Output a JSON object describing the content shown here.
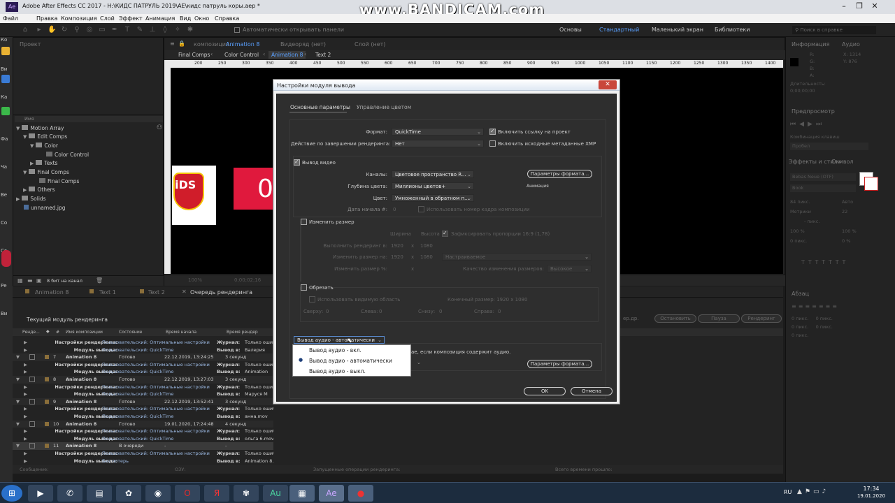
{
  "window": {
    "title": "Adobe After Effects CC 2017 - H:\\КИДС ПАТРУЛЬ 2019\\AE\\кидс патруль коры.aep *"
  },
  "watermark": "www.BANDICAM.com",
  "menu": [
    "Файл",
    "Правка",
    "Композиция",
    "Слой",
    "Эффект",
    "Анимация",
    "Вид",
    "Окно",
    "Справка"
  ],
  "toolbar": {
    "auto_panels": "Автоматически открывать панели",
    "workspaces": [
      "Основы",
      "Стандартный",
      "Маленький экран",
      "Библиотеки"
    ],
    "active_workspace": "Стандартный",
    "search_placeholder": "Поиск в справке"
  },
  "left_edge": [
    "Ко",
    "Ви",
    "Ка",
    "Фа",
    "Ча",
    "Ве",
    "Со",
    "Со",
    "Ре",
    "Ви"
  ],
  "project": {
    "tab": "Проект",
    "col_name": "Имя",
    "bits": "8 бит на канал",
    "items": [
      {
        "name": "Motion Array",
        "level": 0,
        "type": "folder"
      },
      {
        "name": "Edit Comps",
        "level": 1,
        "type": "folder"
      },
      {
        "name": "Color",
        "level": 2,
        "type": "folder"
      },
      {
        "name": "Color Control",
        "level": 3,
        "type": "comp"
      },
      {
        "name": "Texts",
        "level": 2,
        "type": "folder"
      },
      {
        "name": "Final Comps",
        "level": 1,
        "type": "folder"
      },
      {
        "name": "Final Comps",
        "level": 2,
        "type": "comp"
      },
      {
        "name": "Others",
        "level": 1,
        "type": "folder"
      },
      {
        "name": "Solids",
        "level": 0,
        "type": "folder"
      },
      {
        "name": "unnamed.jpg",
        "level": 0,
        "type": "file"
      }
    ]
  },
  "comp_panel": {
    "tab_prefix": "композиция",
    "tab_name": "Animation 8",
    "footage": "Видеоряд (нет)",
    "layer": "Слой (нет)",
    "breadcrumb": [
      "Final Comps",
      "Color Control",
      "Animation 8",
      "Text 2"
    ],
    "active_crumb": "Animation 8",
    "ruler": [
      "200",
      "250",
      "300",
      "350",
      "400",
      "450",
      "500",
      "550",
      "600",
      "650",
      "700",
      "750",
      "800",
      "850",
      "900",
      "950",
      "1000",
      "1050",
      "1100",
      "1150",
      "1200",
      "1250",
      "1300",
      "1350",
      "1400",
      "1450"
    ],
    "logo_text": "iDS",
    "block_text": "0",
    "zoom": "100%",
    "timecode": "0;00;02;16"
  },
  "dialog": {
    "title": "Настройки модуля вывода",
    "close": "✕",
    "tabs": [
      "Основные параметры",
      "Управление цветом"
    ],
    "format_label": "Формат:",
    "format_value": "QuickTime",
    "include_link": "Включить ссылку на проект",
    "post_render_label": "Действие по завершении рендеринга:",
    "post_render_value": "Нет",
    "include_xmp": "Включить исходные метаданные XMP",
    "video_output": "Вывод видео",
    "channels_label": "Каналы:",
    "channels_value": "Цветовое пространство R...",
    "format_options": "Параметры формата...",
    "depth_label": "Глубина цвета:",
    "depth_value": "Миллионы цветов+",
    "codec_note": "Анимация",
    "color_label": "Цвет:",
    "color_value": "Умноженный в обратном п...",
    "start_label": "Дата начала #:",
    "start_value": "0",
    "use_comp_frame": "Использовать номер кадра композиции",
    "resize": "Изменить размер",
    "width": "Ширина",
    "height": "Высота",
    "lock_ratio": "Зафиксировать пропорции 16:9 (1,78)",
    "render_at": "Выполнить рендеринг в:",
    "render_w": "1920",
    "render_h": "1080",
    "resize_to": "Изменить размер на:",
    "resize_w": "1920",
    "resize_h": "1080",
    "custom": "Настраиваемое",
    "resize_pct": "Изменить размер %:",
    "resize_quality": "Качество изменения размеров:",
    "quality_value": "Высокое",
    "crop": "Обрезать",
    "use_roi": "Использовать видимую область",
    "final_size": "Конечный размер: 1920 x 1080",
    "top": "Сверху:",
    "top_v": "0",
    "left": "Слева:",
    "left_v": "0",
    "bottom": "Снизу:",
    "bottom_v": "0",
    "right": "Справа:",
    "right_v": "0",
    "audio_select": "Вывод аудио - автоматически",
    "audio_note": "ае, если композиция содержит аудио.",
    "audio_options": "Параметры формата...",
    "ok": "OK",
    "cancel": "Отмена"
  },
  "audio_popup": {
    "options": [
      "Вывод аудио - вкл.",
      "Вывод аудио - автоматически",
      "Вывод аудио - выкл."
    ],
    "selected": 1
  },
  "render_queue": {
    "tabs": [
      "Animation 8",
      "Text 1",
      "Text 2",
      "Очередь рендеринга"
    ],
    "header": "Текущий модуль рендеринга",
    "cols": [
      "Ренде...",
      "#",
      "Имя композиции",
      "Состояние",
      "Время начала",
      "Время рендер"
    ],
    "buttons": [
      "ер.др.",
      "Остановить",
      "Пауза",
      "Рендеринг"
    ],
    "footer": {
      "msg": "Сообщение:",
      "ozu": "ОЗУ:",
      "ops": "Запущенные операции рендеринга:",
      "total": "Всего времени прошло:"
    },
    "rows": [
      {
        "k": "s",
        "a": "Настройки рендеринга:",
        "b": "Пользовательский: Оптимальные настройки",
        "c": "Журнал:",
        "d": "Только оши"
      },
      {
        "k": "m",
        "a": "Модуль вывода:",
        "b": "Пользовательский: QuickTime",
        "c": "Вывод в:",
        "d": "Валерия"
      },
      {
        "k": "i",
        "n": "7",
        "a": "Animation 8",
        "b": "Готово",
        "t": "22.12.2019, 13:24:25",
        "r": "3 секунд"
      },
      {
        "k": "s",
        "a": "Настройки рендеринга:",
        "b": "Пользовательский: Оптимальные настройки",
        "c": "Журнал:",
        "d": "Только оши"
      },
      {
        "k": "m",
        "a": "Модуль вывода:",
        "b": "Пользовательский: QuickTime",
        "c": "Вывод в:",
        "d": "Animation"
      },
      {
        "k": "i",
        "n": "8",
        "a": "Animation 8",
        "b": "Готово",
        "t": "22.12.2019, 13:27:03",
        "r": "3 секунд"
      },
      {
        "k": "s",
        "a": "Настройки рендеринга:",
        "b": "Пользовательский: Оптимальные настройки",
        "c": "Журнал:",
        "d": "Только оши"
      },
      {
        "k": "m",
        "a": "Модуль вывода:",
        "b": "Пользовательский: QuickTime",
        "c": "Вывод в:",
        "d": "Маруся М"
      },
      {
        "k": "i",
        "n": "9",
        "a": "Animation 8",
        "b": "Готово",
        "t": "22.12.2019, 13:52:41",
        "r": "3 секунд"
      },
      {
        "k": "s",
        "a": "Настройки рендеринга:",
        "b": "Пользовательский: Оптимальные настройки",
        "c": "Журнал:",
        "d": "Только ошибки"
      },
      {
        "k": "m",
        "a": "Модуль вывода:",
        "b": "Пользовательский: QuickTime",
        "c": "Вывод в:",
        "d": "анна.mov"
      },
      {
        "k": "i",
        "n": "10",
        "a": "Animation 8",
        "b": "Готово",
        "t": "19.01.2020, 17:24:48",
        "r": "4 секунд"
      },
      {
        "k": "s",
        "a": "Настройки рендеринга:",
        "b": "Пользовательский: Оптимальные настройки",
        "c": "Журнал:",
        "d": "Только ошибки"
      },
      {
        "k": "m",
        "a": "Модуль вывода:",
        "b": "Пользовательский: QuickTime",
        "c": "Вывод в:",
        "d": "ольга 6.mov"
      },
      {
        "k": "i",
        "n": "11",
        "a": "Animation 8",
        "b": "В очереди",
        "t": "-",
        "r": "-"
      },
      {
        "k": "s",
        "a": "Настройки рендеринга:",
        "b": "Пользовательский: Оптимальные настройки",
        "c": "Журнал:",
        "d": "Только ошибки"
      },
      {
        "k": "m",
        "a": "Модуль вывода:",
        "b": "Без потерь",
        "c": "Вывод в:",
        "d": "Animation 8.avi"
      }
    ]
  },
  "right_panel": {
    "info": "Информация",
    "audio": "Аудио",
    "r": "R:",
    "g": "G:",
    "b": "B:",
    "a": "A:",
    "x": "X: 1314",
    "y": "Y: 876",
    "duration": "Длительность:",
    "duration_v": "0;00;00;00",
    "preview": "Предпросмотр",
    "shortcut": "Комбинация клавиш",
    "shortcut_v": "Пробел",
    "effects": "Эффекты и стили",
    "symbol": "Символ",
    "font": "Bebas Neue (OTF)",
    "style": "Book",
    "size": "84 пикс.",
    "auto": "Авто",
    "metrics": "Метрики",
    "tracking": "22",
    "px": "- пикс.",
    "pct1": "100 %",
    "pct2": "100 %",
    "px0": "0 пикс.",
    "pct0": "0 %",
    "paragraph": "Абзац",
    "p1": "0 пикс.",
    "p2": "0 пикс.",
    "p3": "0 пикс.",
    "p4": "0 пикс.",
    "p5": "0 пикс."
  },
  "taskbar": {
    "lang": "RU",
    "time": "17:34",
    "date": "19.01.2020"
  }
}
